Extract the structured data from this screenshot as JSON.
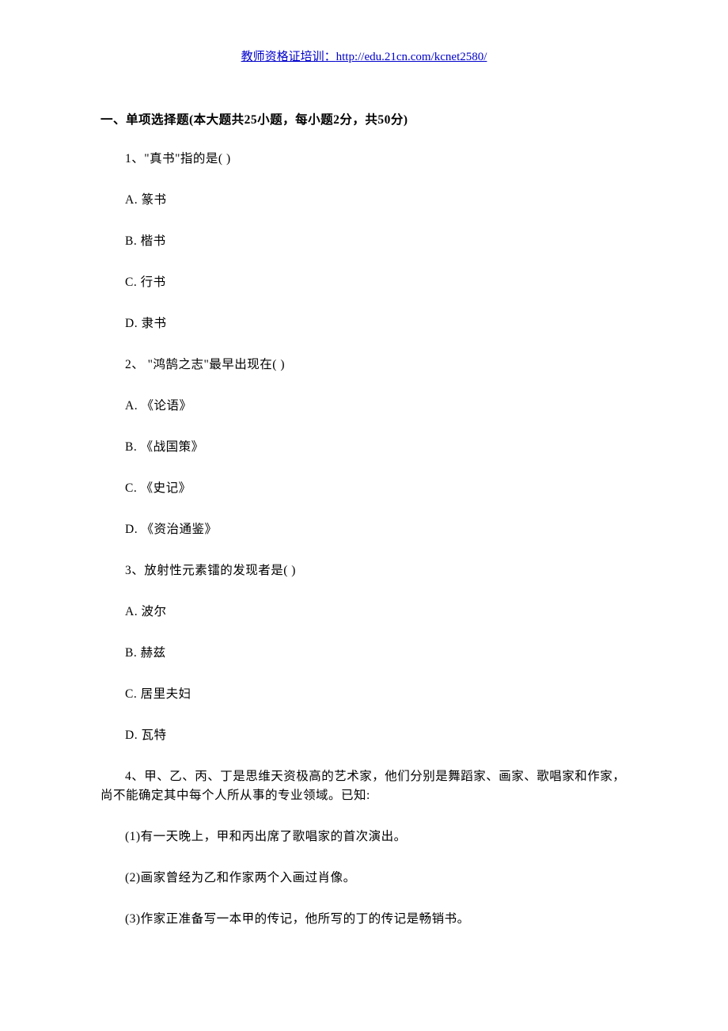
{
  "header": {
    "label": "教师资格证培训：",
    "url": "http://edu.21cn.com/kcnet2580/"
  },
  "section_heading": "一、单项选择题(本大题共25小题，每小题2分，共50分)",
  "lines": [
    "1、\"真书\"指的是( )",
    "A. 篆书",
    "B. 楷书",
    "C. 行书",
    "D. 隶书",
    "2、 \"鸿鹄之志\"最早出现在( )",
    "A. 《论语》",
    "B. 《战国策》",
    "C. 《史记》",
    "D. 《资治通鉴》",
    "3、放射性元素镭的发现者是( )",
    "A. 波尔",
    "B. 赫兹",
    "C. 居里夫妇",
    "D. 瓦特",
    "4、甲、乙、丙、丁是思维天资极高的艺术家，他们分别是舞蹈家、画家、歌唱家和作家，尚不能确定其中每个人所从事的专业领域。已知:",
    "(1)有一天晚上，甲和丙出席了歌唱家的首次演出。",
    "(2)画家曾经为乙和作家两个入画过肖像。",
    "(3)作家正准备写一本甲的传记，他所写的丁的传记是畅销书。"
  ]
}
